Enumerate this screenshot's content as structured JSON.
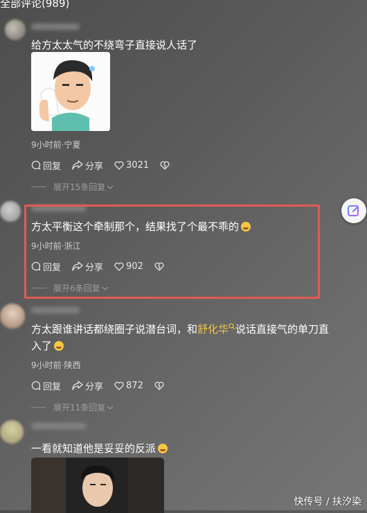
{
  "header": {
    "title": "全部评论(989)"
  },
  "comments": [
    {
      "text": "给方太太气的不绕弯子直接说人话了",
      "meta": "9小时前·宁夏",
      "reply_label": "回复",
      "share_label": "分享",
      "likes": "3021",
      "expand_label": "展开15条回复"
    },
    {
      "text": "方太平衡这个牵制那个，结果找了个最不乖的",
      "meta": "9小时前·浙江",
      "reply_label": "回复",
      "share_label": "分享",
      "likes": "902",
      "expand_label": "展开6条回复"
    },
    {
      "text_before": "方太跟谁讲话都绕圈子说潜台词，和",
      "highlight": "舒化华",
      "text_after": "说话直接气的单刀直入了",
      "meta": "9小时前·陕西",
      "reply_label": "回复",
      "share_label": "分享",
      "likes": "872",
      "expand_label": "展开11条回复"
    },
    {
      "text": "一看就知道他是妥妥的反派"
    }
  ],
  "watermark": "快传号 / 扶汐染",
  "colors": {
    "highlight_box": "#e35a55",
    "highlight_name": "#f5c542"
  }
}
